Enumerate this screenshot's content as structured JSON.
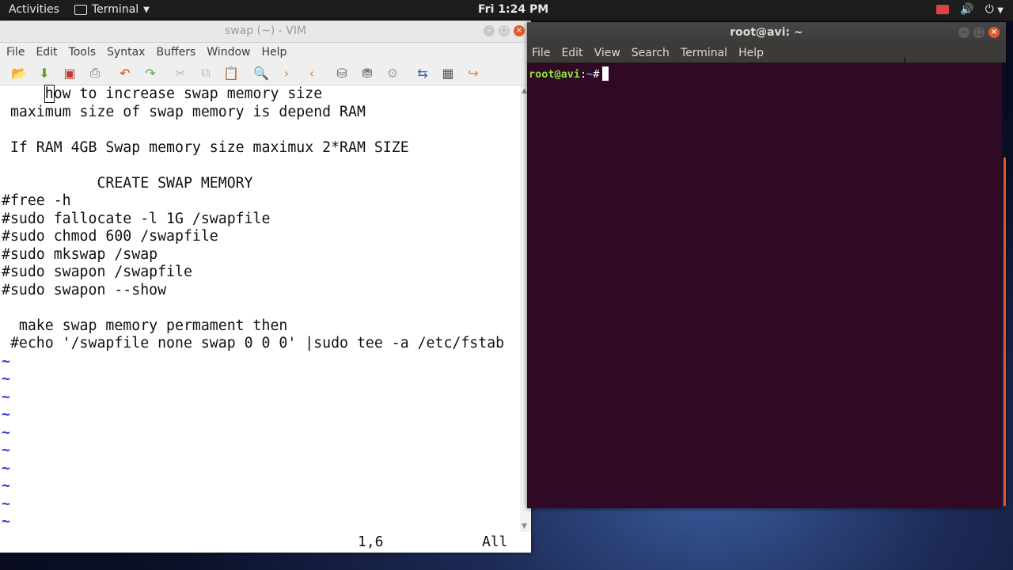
{
  "topbar": {
    "activities": "Activities",
    "app_name": "Terminal",
    "clock": "Fri  1:24 PM"
  },
  "vim": {
    "title": "swap (~) - VIM",
    "menu": [
      "File",
      "Edit",
      "Tools",
      "Syntax",
      "Buffers",
      "Window",
      "Help"
    ],
    "toolbar_icons": [
      "open-icon",
      "save-download-icon",
      "save-icon",
      "print-icon",
      "undo-icon",
      "redo-icon",
      "cut-icon",
      "copy-icon",
      "paste-icon",
      "find-replace-icon",
      "find-next-icon",
      "find-prev-icon",
      "load-session-icon",
      "save-session-icon",
      "run-script-icon",
      "make-icon",
      "shell-icon",
      "ctags-icon"
    ],
    "lines": [
      {
        "text": "     how to increase swap memory size",
        "kind": "text"
      },
      {
        "text": " maximum size of swap memory is depend RAM",
        "kind": "text"
      },
      {
        "text": "",
        "kind": "text"
      },
      {
        "text": " If RAM 4GB Swap memory size maximux 2*RAM SIZE",
        "kind": "text"
      },
      {
        "text": "",
        "kind": "text"
      },
      {
        "text": "           CREATE SWAP MEMORY",
        "kind": "text"
      },
      {
        "text": "#free -h",
        "kind": "text"
      },
      {
        "text": "#sudo fallocate -l 1G /swapfile",
        "kind": "text"
      },
      {
        "text": "#sudo chmod 600 /swapfile",
        "kind": "text"
      },
      {
        "text": "#sudo mkswap /swap",
        "kind": "text"
      },
      {
        "text": "#sudo swapon /swapfile",
        "kind": "text"
      },
      {
        "text": "#sudo swapon --show",
        "kind": "text"
      },
      {
        "text": "",
        "kind": "text"
      },
      {
        "text": "  make swap memory permament then",
        "kind": "text"
      },
      {
        "text": " #echo '/swapfile none swap 0 0 0' |sudo tee -a /etc/fstab",
        "kind": "text"
      },
      {
        "text": "~",
        "kind": "tilde"
      },
      {
        "text": "~",
        "kind": "tilde"
      },
      {
        "text": "~",
        "kind": "tilde"
      },
      {
        "text": "~",
        "kind": "tilde"
      },
      {
        "text": "~",
        "kind": "tilde"
      },
      {
        "text": "~",
        "kind": "tilde"
      },
      {
        "text": "~",
        "kind": "tilde"
      },
      {
        "text": "~",
        "kind": "tilde"
      },
      {
        "text": "~",
        "kind": "tilde"
      },
      {
        "text": "~",
        "kind": "tilde"
      }
    ],
    "status_position": "1,6",
    "status_scroll": "All"
  },
  "terminal": {
    "title": "root@avi: ~",
    "menu": [
      "File",
      "Edit",
      "View",
      "Search",
      "Terminal",
      "Help"
    ],
    "prompt_user": "root@avi",
    "prompt_sep": ":",
    "prompt_path": "~",
    "prompt_char": "#"
  },
  "colors": {
    "terminal_bg": "#300a24",
    "prompt_user": "#8ae234",
    "prompt_path": "#729fcf",
    "vim_tilde": "#2f3fd0",
    "close_button": "#e25a2b"
  }
}
